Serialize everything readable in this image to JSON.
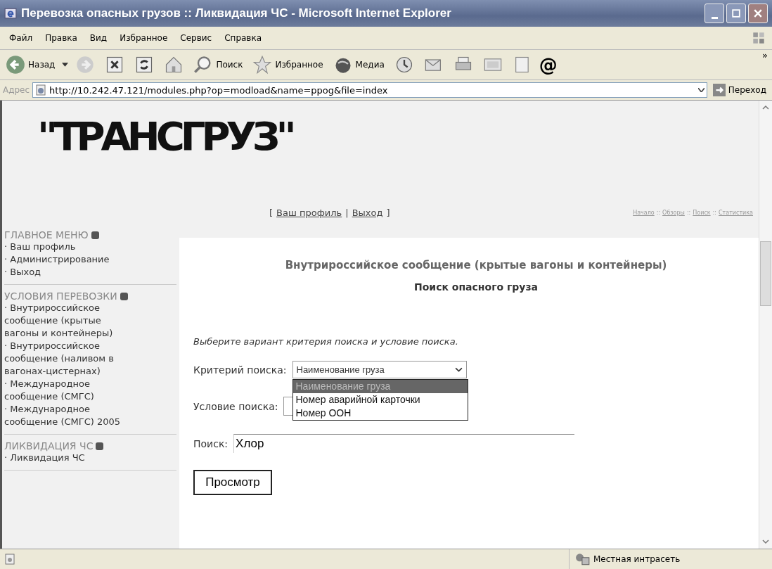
{
  "window": {
    "title": "Перевозка опасных грузов :: Ликвидация ЧС - Microsoft Internet Explorer"
  },
  "menu": [
    "Файл",
    "Правка",
    "Вид",
    "Избранное",
    "Сервис",
    "Справка"
  ],
  "toolbar": [
    {
      "kind": "back",
      "label": "Назад"
    },
    {
      "kind": "caret"
    },
    {
      "kind": "forward"
    },
    {
      "kind": "stop"
    },
    {
      "kind": "refresh"
    },
    {
      "kind": "home"
    },
    {
      "kind": "search",
      "label": "Поиск"
    },
    {
      "kind": "favorites",
      "label": "Избранное"
    },
    {
      "kind": "media",
      "label": "Медиа"
    },
    {
      "kind": "history"
    },
    {
      "kind": "mail"
    },
    {
      "kind": "print"
    },
    {
      "kind": "edit"
    },
    {
      "kind": "page"
    },
    {
      "kind": "glyph",
      "label": "@"
    }
  ],
  "toolbar_more": "»",
  "address": {
    "label": "Адрес",
    "url": "http://10.242.47.121/modules.php?op=modload&name=ppog&file=index",
    "go": "Переход"
  },
  "page": {
    "logo": "\"ТРАНСГРУЗ\"",
    "user_links": [
      {
        "kind": "text",
        "text": "["
      },
      {
        "kind": "link",
        "text": "Ваш профиль"
      },
      {
        "kind": "text",
        "text": "|"
      },
      {
        "kind": "link",
        "text": "Выход"
      },
      {
        "kind": "text",
        "text": "]"
      }
    ],
    "breadcrumb": [
      {
        "kind": "link",
        "text": "Начало"
      },
      {
        "kind": "text",
        "text": "::"
      },
      {
        "kind": "link",
        "text": "Обзоры"
      },
      {
        "kind": "text",
        "text": "::"
      },
      {
        "kind": "link",
        "text": "Поиск"
      },
      {
        "kind": "text",
        "text": "::"
      },
      {
        "kind": "link",
        "text": "Статистика"
      }
    ],
    "sidebar": [
      {
        "title": "ГЛАВНОЕ МЕНЮ",
        "items": [
          "· Ваш профиль",
          "· Администрирование",
          "· Выход"
        ]
      },
      {
        "title": "УСЛОВИЯ ПЕРЕВОЗКИ",
        "items": [
          "· Внутрироссийское сообщение (крытые вагоны и контейнеры)",
          "· Внутрироссийское сообщение (наливом в вагонах-цистернах)",
          "· Международное сообщение (СМГС)",
          "· Международное сообщение (СМГС) 2005"
        ]
      },
      {
        "title": "ЛИКВИДАЦИЯ ЧС",
        "items": [
          "· Ликвидация ЧС"
        ]
      }
    ],
    "heading": "Внутрироссийское сообщение (крытые вагоны и контейнеры)",
    "subheading": "Поиск опасного груза",
    "instruction": "Выберите вариант критерия поиска и условие поиска.",
    "criterion": {
      "label": "Критерий поиска:",
      "value": "Наименование груза",
      "options": [
        {
          "label": "Наименование груза",
          "selected": true
        },
        {
          "label": "Номер аварийной карточки",
          "selected": false
        },
        {
          "label": "Номер ООН",
          "selected": false
        }
      ]
    },
    "condition": {
      "label": "Условие поиска:"
    },
    "search": {
      "label": "Поиск:",
      "value": "Хлор"
    },
    "submit": "Просмотр"
  },
  "status_bar": {
    "zone": "Местная интрасеть"
  }
}
